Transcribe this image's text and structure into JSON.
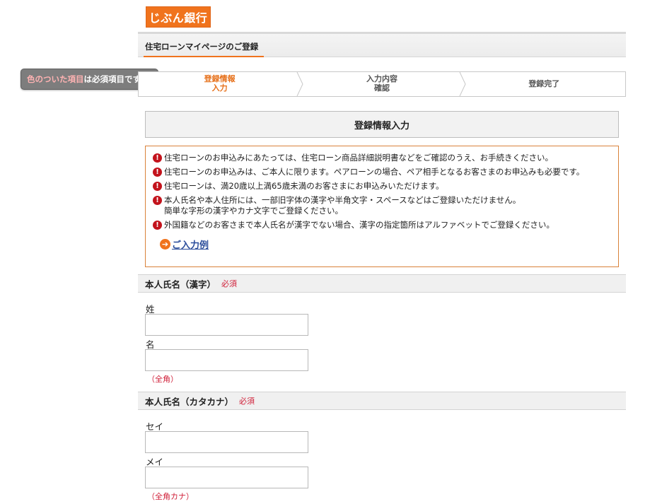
{
  "logo": {
    "text": "じぶん銀行"
  },
  "header": {
    "title": "住宅ローンマイページのご登録"
  },
  "required_note": {
    "accent": "色のついた項目",
    "rest": "は必須項目です。"
  },
  "steps": [
    {
      "label": "登録情報\n入力",
      "active": true
    },
    {
      "label": "入力内容\n確認",
      "active": false
    },
    {
      "label": "登録完了",
      "active": false
    }
  ],
  "section": {
    "title": "登録情報入力"
  },
  "notices": [
    "住宅ローンのお申込みにあたっては、住宅ローン商品詳細説明書などをご確認のうえ、お手続きください。",
    "住宅ローンのお申込みは、ご本人に限ります。ペアローンの場合、ペア相手となるお客さまのお申込みも必要です。",
    "住宅ローンは、満20歳以上満65歳未満のお客さまにお申込みいただけます。",
    "本人氏名や本人住所には、一部旧字体の漢字や半角文字・スペースなどはご登録いただけません。\n簡単な字形の漢字やカナ文字でご登録ください。",
    "外国籍などのお客さまで本人氏名が漢字でない場合、漢字の指定箇所はアルファベットでご登録ください。"
  ],
  "input_example": {
    "label": "ご入力例"
  },
  "kanji_name": {
    "title": "本人氏名（漢字）",
    "required": "必須",
    "last_label": "姓",
    "first_label": "名",
    "last_value": "",
    "first_value": "",
    "hint": "（全角）"
  },
  "kana_name": {
    "title": "本人氏名（カタカナ）",
    "required": "必須",
    "last_label": "セイ",
    "first_label": "メイ",
    "last_value": "",
    "first_value": "",
    "hint": "（全角カナ）"
  },
  "colors": {
    "brand": "#f0731d",
    "required": "#d0213a",
    "warning": "#c3131c",
    "link": "#2b4d9b"
  },
  "icons": {
    "warning": "exclamation-circle-icon",
    "arrow": "arrow-right-circle-icon",
    "chevron": "chevron-right-icon"
  }
}
